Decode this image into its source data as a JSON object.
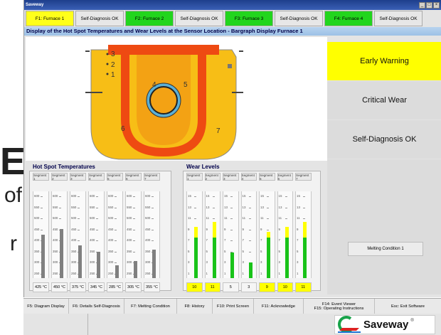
{
  "window": {
    "title": "Saveway"
  },
  "tabs": [
    {
      "label": "F1: Furnace 1",
      "color": "#ffff1a"
    },
    {
      "label": "Self-Diagnosis OK",
      "color": "#e7e7e7"
    },
    {
      "label": "F2: Furnace 2",
      "color": "#22d51d"
    },
    {
      "label": "Self-Diagnosis OK",
      "color": "#e7e7e7"
    },
    {
      "label": "F3: Furnace 3",
      "color": "#22d51d"
    },
    {
      "label": "Self-Diagnosis OK",
      "color": "#e7e7e7"
    },
    {
      "label": "F4: Furnace 4",
      "color": "#22d51d"
    },
    {
      "label": "Self-Diagnosis OK",
      "color": "#e7e7e7"
    }
  ],
  "heading": "Display of the Hot Spot Temperatures and Wear Levels at the Sensor Location - Bargraph Display Furnace 1",
  "diagram": {
    "labels": [
      "3",
      "2",
      "1",
      "4",
      "5",
      "6",
      "7"
    ]
  },
  "status": {
    "early_warning": "Early Warning",
    "critical_wear": "Critical Wear",
    "self_diagnosis": "Self-Diagnosis OK"
  },
  "hot_spot": {
    "title": "Hot Spot Temperatures",
    "scale": [
      "600",
      "550",
      "500",
      "450",
      "400",
      "350",
      "300",
      "250"
    ],
    "segments": [
      {
        "name": "Segment 1",
        "value": 425,
        "label": "425 °C"
      },
      {
        "name": "Segment 2",
        "value": 450,
        "label": "450 °C"
      },
      {
        "name": "Segment 3",
        "value": 375,
        "label": "375 °C"
      },
      {
        "name": "Segment 4",
        "value": 345,
        "label": "345 °C"
      },
      {
        "name": "Segment 5",
        "value": 285,
        "label": "285 °C"
      },
      {
        "name": "Segment 6",
        "value": 305,
        "label": "305 °C"
      },
      {
        "name": "Segment 7",
        "value": 355,
        "label": "355 °C"
      }
    ]
  },
  "wear": {
    "title": "Wear Levels",
    "scale": [
      "15",
      "13",
      "11",
      "9",
      "7",
      "5",
      "3",
      "1"
    ],
    "segments": [
      {
        "name": "Segment 1",
        "value": 10,
        "label": "10",
        "highlight": true
      },
      {
        "name": "Segment 2",
        "value": 11,
        "label": "11",
        "highlight": true
      },
      {
        "name": "Segment 3",
        "value": 5,
        "label": "5",
        "highlight": false
      },
      {
        "name": "Segment 4",
        "value": 3,
        "label": "3",
        "highlight": false
      },
      {
        "name": "Segment 5",
        "value": 9,
        "label": "9",
        "highlight": true
      },
      {
        "name": "Segment 6",
        "value": 10,
        "label": "10",
        "highlight": true
      },
      {
        "name": "Segment 7",
        "value": 11,
        "label": "11",
        "highlight": true
      }
    ]
  },
  "melting_condition": "Melting Condition 1",
  "fkeys": [
    {
      "line1": "F5: Diagram Display",
      "line2": ""
    },
    {
      "line1": "F6: Details Self-Diagnosis",
      "line2": ""
    },
    {
      "line1": "F7: Melting Condition",
      "line2": ""
    },
    {
      "line1": "F8: History",
      "line2": ""
    },
    {
      "line1": "F10: Print Screen",
      "line2": ""
    },
    {
      "line1": "F11: Acknowledge",
      "line2": ""
    },
    {
      "line1": "F14: Event Viewer",
      "line2": "F15: Operating Instructions"
    },
    {
      "line1": "Esc: Exit Software",
      "line2": ""
    }
  ],
  "logo": {
    "text": "Saveway",
    "reg": "®"
  },
  "background_text": {
    "big": "E",
    "line1": "of",
    "line2": "r"
  },
  "colors": {
    "warning": "#ffff00",
    "ok_green": "#22d51d",
    "temp_bar": "#808080",
    "wear_green": "#19c319",
    "wear_yellow": "#ffff00",
    "refractory": "#f7be16",
    "hot_zone": "#ee4a12"
  }
}
